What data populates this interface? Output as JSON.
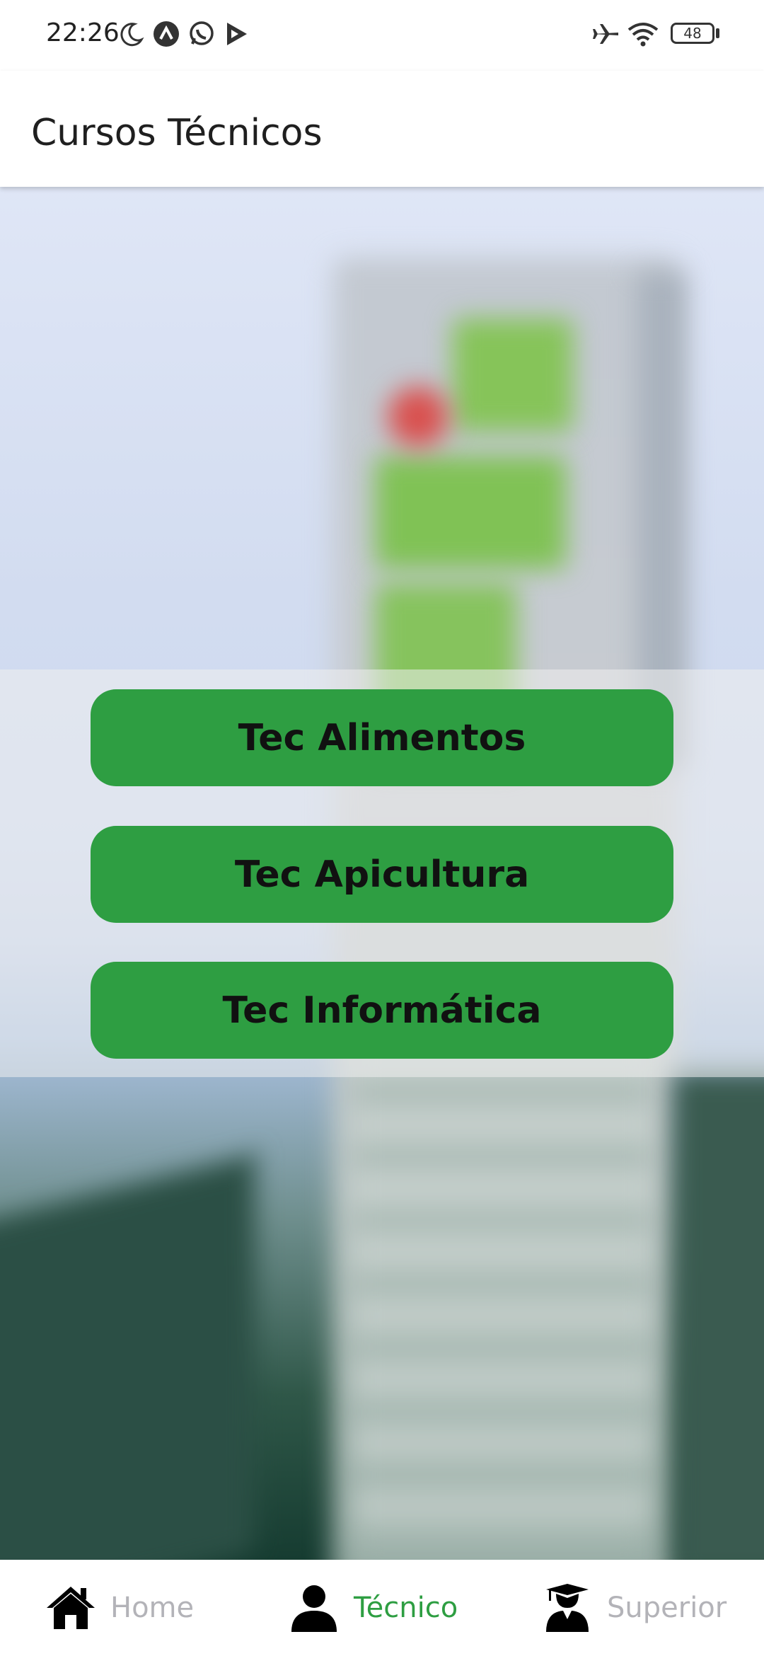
{
  "status_bar": {
    "time": "22:26",
    "battery": "48",
    "icons": [
      "moon-icon",
      "circle-a-icon",
      "whatsapp-icon",
      "play-icon",
      "airplane-icon",
      "wifi-icon",
      "battery-icon"
    ]
  },
  "app_bar": {
    "title": "Cursos Técnicos"
  },
  "courses": [
    {
      "label": "Tec Alimentos"
    },
    {
      "label": "Tec Apicultura"
    },
    {
      "label": "Tec Informática"
    }
  ],
  "bottom_nav": {
    "items": [
      {
        "label": "Home",
        "icon": "home-icon",
        "active": false
      },
      {
        "label": "Técnico",
        "icon": "user-icon",
        "active": true
      },
      {
        "label": "Superior",
        "icon": "graduate-icon",
        "active": false
      }
    ]
  },
  "colors": {
    "accent": "#2e9e42",
    "active_nav": "#2e9e42",
    "inactive_nav": "#b3b3b8"
  }
}
